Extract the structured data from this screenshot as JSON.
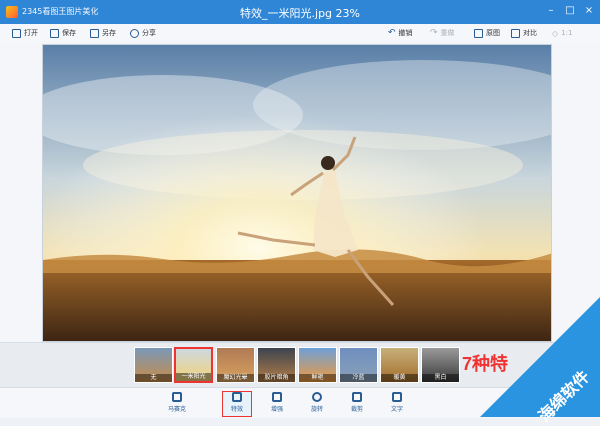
{
  "window": {
    "app_name": "2345看图王图片美化",
    "title": "特效_一米阳光.jpg 23%",
    "controls": {
      "minimize": "–",
      "maximize": "□",
      "close": "×"
    }
  },
  "toolbar": {
    "open": "打开",
    "save": "保存",
    "save_as": "另存",
    "share": "分享",
    "undo": "撤销",
    "redo": "重做",
    "original": "原图",
    "compare": "对比",
    "ratio": "1:1"
  },
  "filmstrip": {
    "thumbs": [
      {
        "label": "无"
      },
      {
        "label": "一米阳光"
      },
      {
        "label": "魔幻光晕"
      },
      {
        "label": "胶片暗角"
      },
      {
        "label": "鲜艳"
      },
      {
        "label": "冷蓝"
      },
      {
        "label": "暖黄"
      },
      {
        "label": "黑白"
      }
    ],
    "selected_index": 1,
    "promo": "7种特"
  },
  "bottom_tools": [
    {
      "label": "马赛克",
      "icon": "mosaic-icon"
    },
    {
      "label": "特效",
      "icon": "magic-wand-icon"
    },
    {
      "label": "增强",
      "icon": "sliders-icon"
    },
    {
      "label": "旋转",
      "icon": "rotate-icon"
    },
    {
      "label": "裁剪",
      "icon": "crop-icon"
    },
    {
      "label": "文字",
      "icon": "text-icon"
    }
  ],
  "watermark": {
    "text": "海绵软件"
  }
}
